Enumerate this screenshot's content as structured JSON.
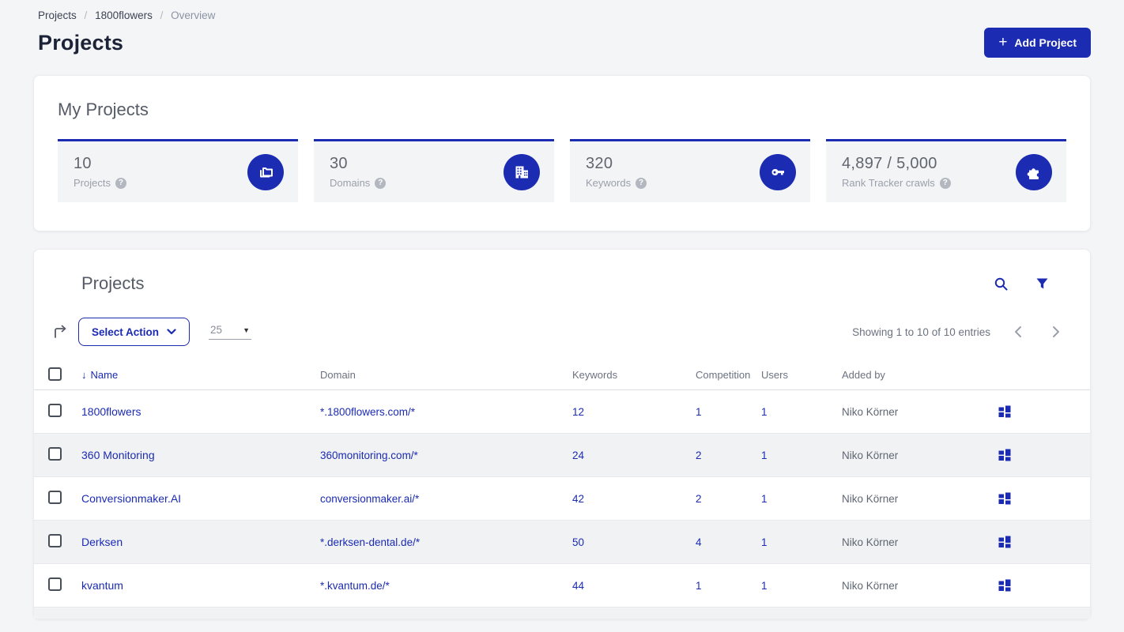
{
  "breadcrumb": {
    "items": [
      {
        "label": "Projects"
      },
      {
        "label": "1800flowers"
      },
      {
        "label": "Overview"
      }
    ],
    "separator": "/"
  },
  "header": {
    "title": "Projects",
    "add_button_label": "Add Project",
    "plus_glyph": "+"
  },
  "stats": {
    "title": "My Projects",
    "cards": [
      {
        "value": "10",
        "label": "Projects",
        "icon": "folders-icon",
        "help_glyph": "?"
      },
      {
        "value": "30",
        "label": "Domains",
        "icon": "building-icon",
        "help_glyph": "?"
      },
      {
        "value": "320",
        "label": "Keywords",
        "icon": "key-icon",
        "help_glyph": "?"
      },
      {
        "value": "4,897 / 5,000",
        "label": "Rank Tracker crawls",
        "icon": "puzzle-icon",
        "help_glyph": "?"
      }
    ]
  },
  "table_card": {
    "title": "Projects",
    "toolbar": {
      "select_action_label": "Select Action",
      "page_size_value": "25",
      "showing_text": "Showing 1 to 10 of 10 entries"
    },
    "columns": {
      "name": "Name",
      "domain": "Domain",
      "keywords": "Keywords",
      "competition": "Competition",
      "users": "Users",
      "added_by": "Added by"
    },
    "sort_arrow_glyph": "↓",
    "rows": [
      {
        "name": "1800flowers",
        "domain": "*.1800flowers.com/*",
        "keywords": "12",
        "competition": "1",
        "users": "1",
        "added_by": "Niko Körner"
      },
      {
        "name": "360 Monitoring",
        "domain": "360monitoring.com/*",
        "keywords": "24",
        "competition": "2",
        "users": "1",
        "added_by": "Niko Körner"
      },
      {
        "name": "Conversionmaker.AI",
        "domain": "conversionmaker.ai/*",
        "keywords": "42",
        "competition": "2",
        "users": "1",
        "added_by": "Niko Körner"
      },
      {
        "name": "Derksen",
        "domain": "*.derksen-dental.de/*",
        "keywords": "50",
        "competition": "4",
        "users": "1",
        "added_by": "Niko Körner"
      },
      {
        "name": "kvantum",
        "domain": "*.kvantum.de/*",
        "keywords": "44",
        "competition": "1",
        "users": "1",
        "added_by": "Niko Körner"
      }
    ]
  },
  "colors": {
    "accent_blue": "#1b2bb2",
    "page_background": "#f4f5f7",
    "stat_card_background": "#f3f4f6",
    "row_alt_background": "#f1f2f4",
    "heading_dark": "#1c2336",
    "muted_gray": "#9aa0ab"
  }
}
